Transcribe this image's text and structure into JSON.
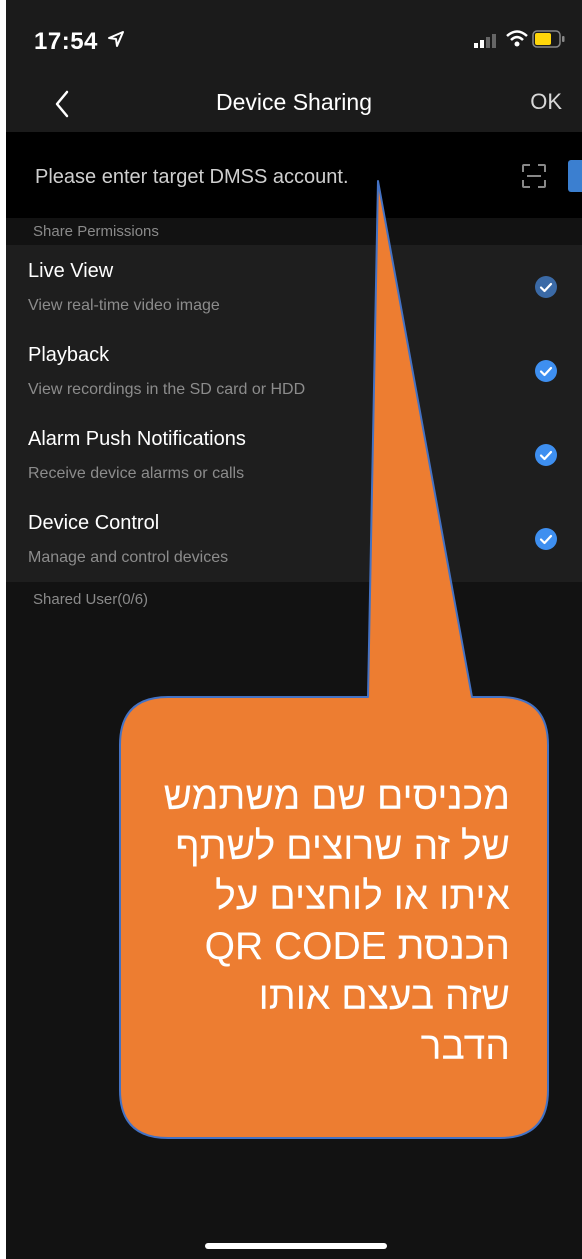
{
  "status_bar": {
    "time": "17:54"
  },
  "nav": {
    "title": "Device Sharing",
    "ok_label": "OK"
  },
  "account": {
    "placeholder": "Please enter target DMSS account."
  },
  "permissions": {
    "section_title": "Share Permissions",
    "items": [
      {
        "title": "Live View",
        "description": "View real-time video image",
        "checked": true
      },
      {
        "title": "Playback",
        "description": "View recordings in the SD card or HDD",
        "checked": true
      },
      {
        "title": "Alarm Push Notifications",
        "description": "Receive device alarms or calls",
        "checked": true
      },
      {
        "title": "Device Control",
        "description": "Manage and control devices",
        "checked": true
      }
    ]
  },
  "shared_users": {
    "label": "Shared User(0/6)"
  },
  "annotation": {
    "lines": [
      "מכניסים שם משתמש",
      "של זה שרוצים לשתף",
      "איתו או לוחצים על",
      "הכנסת QR CODE",
      "שזה בעצם אותו",
      "הדבר"
    ],
    "fill_color": "#ed7d31",
    "stroke_color": "#4472c4"
  },
  "colors": {
    "accent": "#3e8ff0",
    "background": "#121212"
  }
}
